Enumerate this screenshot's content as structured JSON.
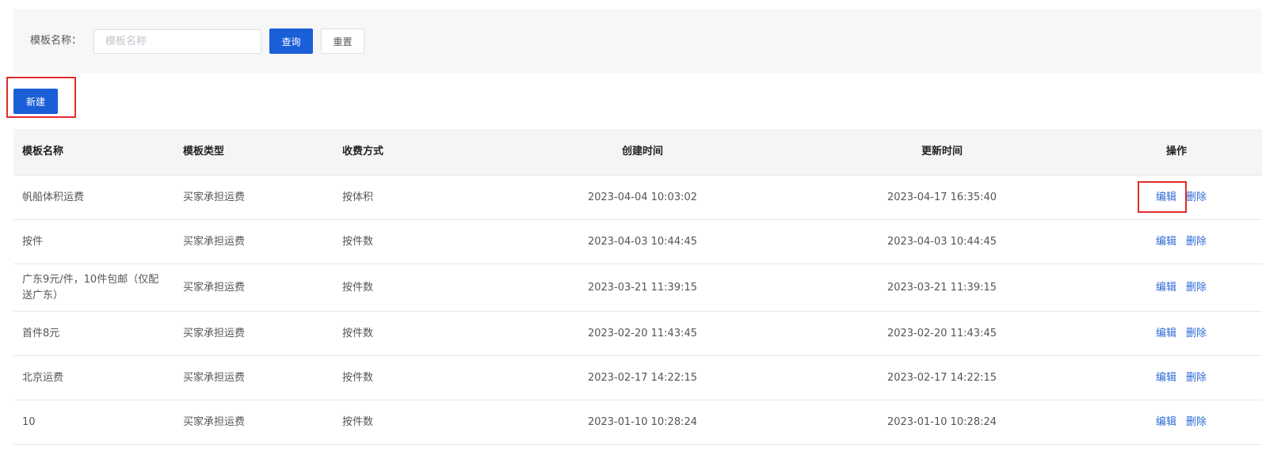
{
  "search": {
    "label": "模板名称：",
    "placeholder": "模板名称",
    "value": "",
    "query_label": "查询",
    "reset_label": "重置"
  },
  "toolbar": {
    "new_label": "新建"
  },
  "table": {
    "columns": [
      "模板名称",
      "模板类型",
      "收费方式",
      "创建时间",
      "更新时间",
      "操作"
    ],
    "rows": [
      {
        "name": "帆船体积运费",
        "type": "买家承担运费",
        "fee": "按体积",
        "created": "2023-04-04 10:03:02",
        "updated": "2023-04-17 16:35:40",
        "edit": "编辑",
        "delete": "删除"
      },
      {
        "name": "按件",
        "type": "买家承担运费",
        "fee": "按件数",
        "created": "2023-04-03 10:44:45",
        "updated": "2023-04-03 10:44:45",
        "edit": "编辑",
        "delete": "删除"
      },
      {
        "name": "广东9元/件，10件包邮（仅配送广东）",
        "type": "买家承担运费",
        "fee": "按件数",
        "created": "2023-03-21 11:39:15",
        "updated": "2023-03-21 11:39:15",
        "edit": "编辑",
        "delete": "删除"
      },
      {
        "name": "首件8元",
        "type": "买家承担运费",
        "fee": "按件数",
        "created": "2023-02-20 11:43:45",
        "updated": "2023-02-20 11:43:45",
        "edit": "编辑",
        "delete": "删除"
      },
      {
        "name": "北京运费",
        "type": "买家承担运费",
        "fee": "按件数",
        "created": "2023-02-17 14:22:15",
        "updated": "2023-02-17 14:22:15",
        "edit": "编辑",
        "delete": "删除"
      },
      {
        "name": "10",
        "type": "买家承担运费",
        "fee": "按件数",
        "created": "2023-01-10 10:28:24",
        "updated": "2023-01-10 10:28:24",
        "edit": "编辑",
        "delete": "删除"
      }
    ]
  },
  "colors": {
    "primary": "#1a5fd8",
    "link": "#2d6ad6",
    "highlight": "#e32b2b",
    "panel_bg": "#f7f7f8",
    "header_bg": "#f4f5f7"
  }
}
